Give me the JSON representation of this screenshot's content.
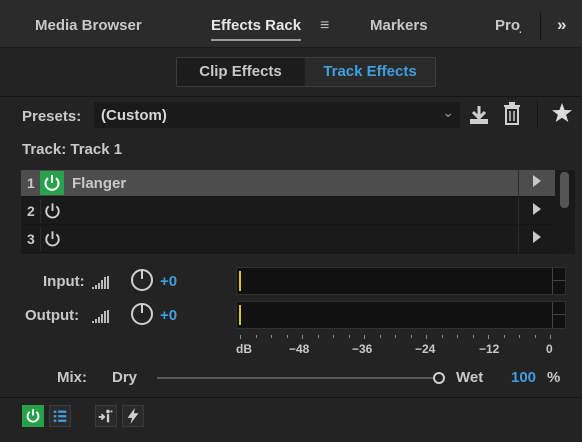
{
  "tabs": [
    "Media Browser",
    "Effects Rack",
    "Markers",
    "Proj"
  ],
  "active_tab": "Effects Rack",
  "tab_menu_icon": "hamburger-icon",
  "tab_overflow": "»",
  "segments": {
    "clip": "Clip Effects",
    "track": "Track Effects",
    "active": "Track Effects"
  },
  "presets": {
    "label": "Presets:",
    "value": "(Custom)"
  },
  "toolbar_icons": [
    "download-icon",
    "trash-icon",
    "star-icon"
  ],
  "track_label": "Track: Track 1",
  "rack": {
    "rows": [
      {
        "num": "1",
        "name": "Flanger",
        "power_on": true,
        "selected": true
      },
      {
        "num": "2",
        "name": "",
        "power_on": false,
        "selected": false
      },
      {
        "num": "3",
        "name": "",
        "power_on": false,
        "selected": false
      }
    ]
  },
  "input": {
    "label": "Input:",
    "value": "+0"
  },
  "output": {
    "label": "Output:",
    "value": "+0"
  },
  "meter_scale": [
    "dB",
    "−48",
    "−36",
    "−24",
    "−12",
    "0"
  ],
  "mix": {
    "label": "Mix:",
    "dry": "Dry",
    "wet": "Wet",
    "value": "100",
    "unit": "%",
    "level_percent": 100
  },
  "footer_icons": [
    "power-icon",
    "list-icon",
    "routing-icon",
    "lightning-icon"
  ],
  "colors": {
    "accent": "#3f9fe0",
    "power_green": "#27a14b",
    "peak_yellow": "#d8c23a"
  }
}
